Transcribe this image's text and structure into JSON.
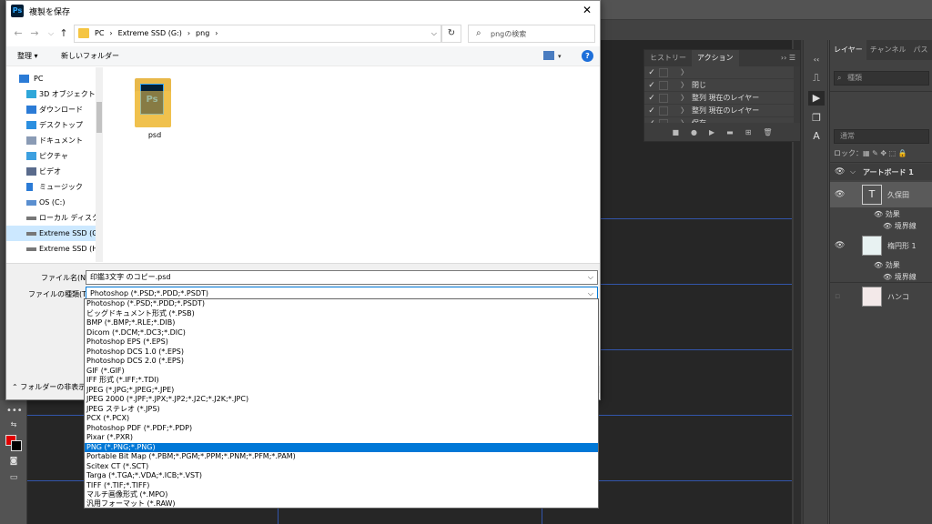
{
  "dialog": {
    "title": "複製を保存",
    "app_badge": "Ps",
    "breadcrumb": [
      "PC",
      "›",
      "Extreme SSD (G:)",
      "›",
      "png",
      "›"
    ],
    "search_placeholder": "pngの検索",
    "toolbar": {
      "organize": "整理 ▾",
      "new_folder": "新しいフォルダー"
    },
    "nav_items": [
      {
        "label": "PC",
        "icon": "pc-icon",
        "color": "#2b7bd6",
        "indent": 1,
        "selected": false
      },
      {
        "label": "3D オブジェクト",
        "icon": "3d-objects-icon",
        "color": "#2fa7d9",
        "indent": 2,
        "selected": false
      },
      {
        "label": "ダウンロード",
        "icon": "download-icon",
        "color": "#2b7bd6",
        "indent": 2,
        "selected": false
      },
      {
        "label": "デスクトップ",
        "icon": "desktop-icon",
        "color": "#2b8fe0",
        "indent": 2,
        "selected": false
      },
      {
        "label": "ドキュメント",
        "icon": "documents-icon",
        "color": "#8a9bb5",
        "indent": 2,
        "selected": false
      },
      {
        "label": "ピクチャ",
        "icon": "pictures-icon",
        "color": "#3da0e0",
        "indent": 2,
        "selected": false
      },
      {
        "label": "ビデオ",
        "icon": "videos-icon",
        "color": "#5a6b8c",
        "indent": 2,
        "selected": false
      },
      {
        "label": "ミュージック",
        "icon": "music-icon",
        "color": "#2b7bd6",
        "indent": 2,
        "selected": false
      },
      {
        "label": "OS (C:)",
        "icon": "drive-c-icon",
        "color": "#5a8fd0",
        "indent": 2,
        "selected": false
      },
      {
        "label": "ローカル ディスク (D",
        "icon": "drive-d-icon",
        "color": "#777777",
        "indent": 2,
        "selected": false
      },
      {
        "label": "Extreme SSD (G:)",
        "icon": "drive-g-icon",
        "color": "#777777",
        "indent": 2,
        "selected": true
      },
      {
        "label": "Extreme SSD (H:)",
        "icon": "drive-h-icon",
        "color": "#777777",
        "indent": 2,
        "selected": false
      }
    ],
    "file": {
      "name": "psd",
      "badge": "Ps"
    },
    "filename_label": "ファイル名(N):",
    "filename_value": "印鑑3文字 のコピー.psd",
    "filetype_label": "ファイルの種類(T):",
    "filetype_value": "Photoshop (*.PSD;*.PDD;*.PSDT)",
    "hide_folders": "フォルダーの非表示",
    "file_types": [
      "Photoshop (*.PSD;*.PDD;*.PSDT)",
      "ビッグドキュメント形式 (*.PSB)",
      "BMP (*.BMP;*.RLE;*.DIB)",
      "Dicom (*.DCM;*.DC3;*.DIC)",
      "Photoshop EPS (*.EPS)",
      "Photoshop DCS 1.0 (*.EPS)",
      "Photoshop DCS 2.0 (*.EPS)",
      "GIF (*.GIF)",
      "IFF 形式 (*.IFF;*.TDI)",
      "JPEG (*.JPG;*.JPEG;*.JPE)",
      "JPEG 2000 (*.JPF;*.JPX;*.JP2;*.J2C;*.J2K;*.JPC)",
      "JPEG ステレオ (*.JPS)",
      "PCX (*.PCX)",
      "Photoshop PDF (*.PDF;*.PDP)",
      "Pixar (*.PXR)",
      "PNG (*.PNG;*.PNG)",
      "Portable Bit Map (*.PBM;*.PGM;*.PPM;*.PNM;*.PFM;*.PAM)",
      "Scitex CT (*.SCT)",
      "Targa (*.TGA;*.VDA;*.ICB;*.VST)",
      "TIFF (*.TIF;*.TIFF)",
      "マルチ画像形式 (*.MPO)",
      "汎用フォーマット (*.RAW)"
    ],
    "highlighted_type_index": 15
  },
  "actions_panel": {
    "tabs": [
      "ヒストリー",
      "アクション"
    ],
    "active_tab": "アクション",
    "menu_glyph": "›› ☰",
    "rows": [
      {
        "check": "✓",
        "label": ""
      },
      {
        "check": "✓",
        "label": "閉じ"
      },
      {
        "check": "✓",
        "label": "整列 現在のレイヤー"
      },
      {
        "check": "✓",
        "label": "整列 現在のレイヤー"
      },
      {
        "check": "✓",
        "label": "保存"
      }
    ],
    "footer_icons": [
      "stop-icon",
      "record-icon",
      "play-icon",
      "folder-icon",
      "new-action-icon",
      "trash-icon"
    ]
  },
  "layers_panel": {
    "tabs": [
      "レイヤー",
      "チャンネル",
      "パス"
    ],
    "active_tab": "レイヤー",
    "filter_placeholder": "種類",
    "blend_mode": "通常",
    "lock_label": "ロック：",
    "lock_icons": "▦ ✎ ✥ ⬚ 🔒",
    "artboard": "アートボード 1",
    "layers": [
      {
        "name": "久保田",
        "type": "text",
        "visible": true,
        "effects_label": "効果",
        "effect": "境界線"
      },
      {
        "name": "楕円形 1",
        "type": "shape",
        "visible": true,
        "effects_label": "効果",
        "effect": "境界線"
      },
      {
        "name": "ハンコ",
        "type": "image",
        "visible": false
      }
    ]
  },
  "colors": {
    "foreground": "#e00000",
    "background": "#000000",
    "selection": "#0078d7",
    "nav_selected": "#cce8ff"
  }
}
